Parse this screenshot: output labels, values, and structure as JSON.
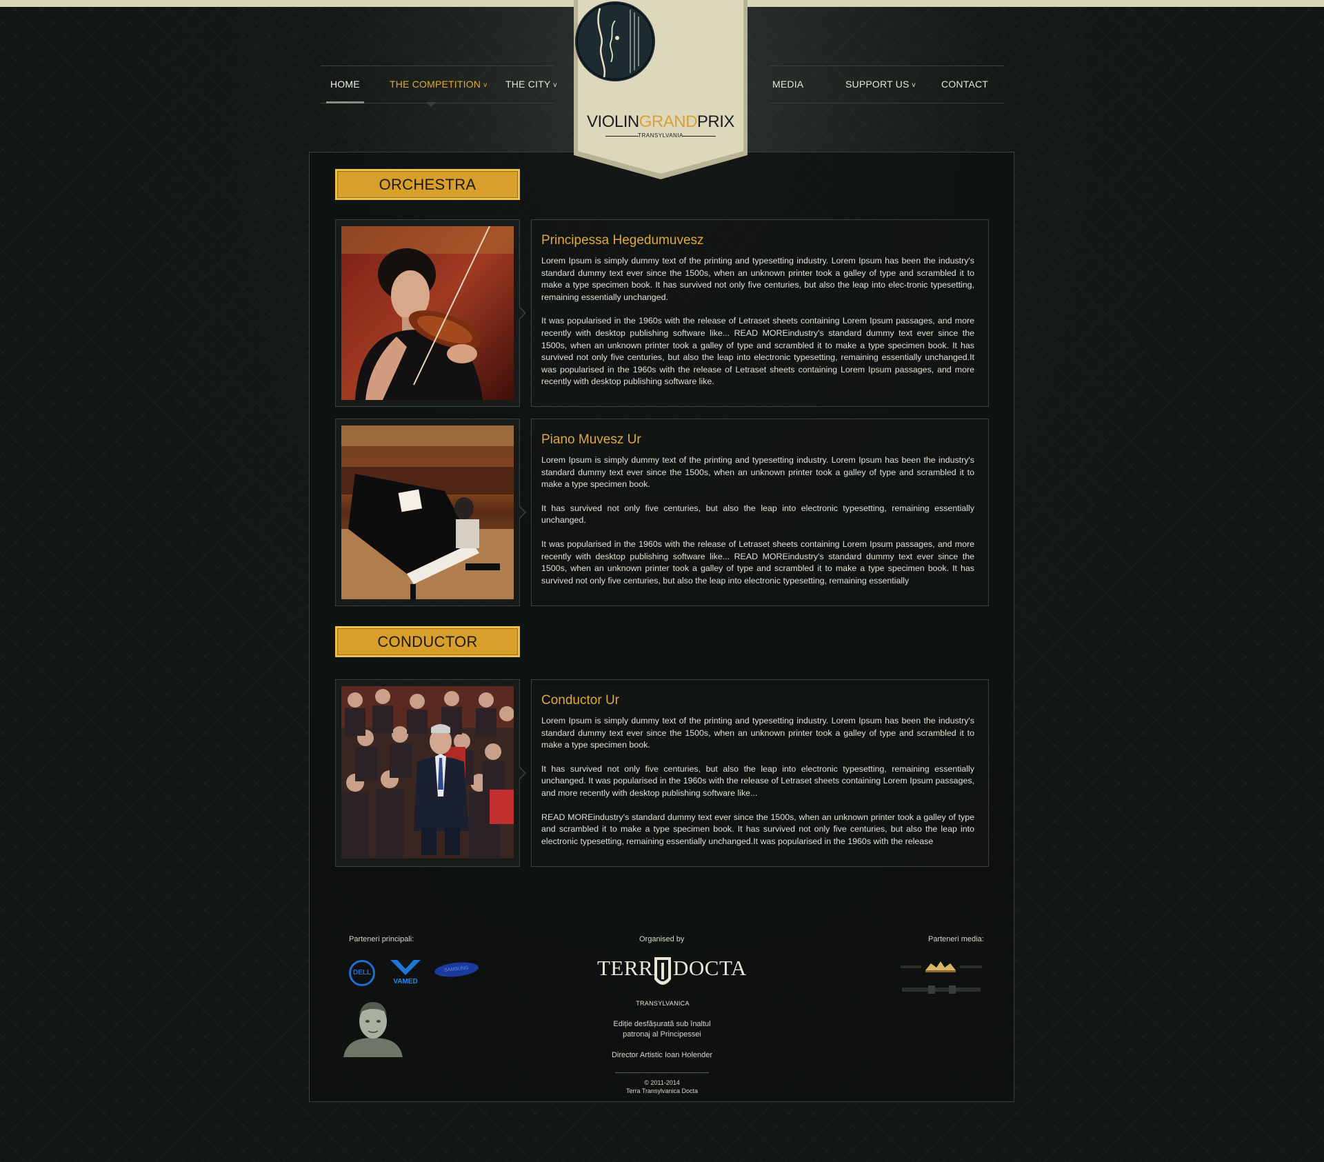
{
  "nav": {
    "left": [
      {
        "label": "HOME",
        "chevron": ""
      },
      {
        "label": "THE COMPETITION",
        "chevron": "v"
      },
      {
        "label": "THE CITY",
        "chevron": "v"
      }
    ],
    "right": [
      {
        "label": "MEDIA",
        "chevron": ""
      },
      {
        "label": "SUPPORT US",
        "chevron": "v"
      },
      {
        "label": "CONTACT",
        "chevron": ""
      }
    ]
  },
  "logo": {
    "word1": "VIOLIN",
    "word2": "GRAND",
    "word3": "PRIX",
    "subtitle": "TRANSYLVANIA",
    "emblem_icon": "violin-scroll-emblem-icon"
  },
  "sections": [
    {
      "label": "ORCHESTRA"
    },
    {
      "label": "CONDUCTOR"
    }
  ],
  "entries": [
    {
      "name": "Principessa Hegedumuvesz",
      "photo": "violinist-photo",
      "paragraphs": [
        "Lorem Ipsum is simply dummy text of the printing and typesetting industry. Lorem Ipsum has been the industry's standard dummy text ever since the 1500s, when an unknown printer took a galley of type and scrambled it to make a type specimen book. It has survived not only five centuries, but also the leap into elec-tronic typesetting, remaining essentially unchanged.",
        "It was popularised in the 1960s with the release of Letraset sheets containing Lorem Ipsum passages, and more recently with desktop publishing software like... READ MOREindustry's standard dummy text ever since the 1500s, when an unknown printer took a galley of type and scrambled it to make a type specimen book. It has survived not only five centuries, but also the leap into electronic typesetting, remaining essentially unchanged.It was popularised in the 1960s with the release of Letraset sheets containing Lorem Ipsum passages, and more recently with desktop publishing software like."
      ]
    },
    {
      "name": "Piano Muvesz Ur",
      "photo": "pianist-photo",
      "paragraphs": [
        "Lorem Ipsum is simply dummy text of the printing and typesetting industry. Lorem Ipsum has been the industry's standard dummy text ever since the 1500s, when an unknown printer took a galley of type and scrambled it to make a type specimen book.",
        "It has survived not only five centuries, but also the leap into electronic typesetting, remaining essentially unchanged.",
        "It was popularised in the 1960s with the release of Letraset sheets containing Lorem Ipsum passages, and more recently with desktop publishing software like... READ MOREindustry's standard dummy text ever since the 1500s, when an unknown printer took a galley of type and scrambled it to make a type specimen book. It has survived not only five centuries, but also the leap into electronic typesetting, remaining essentially"
      ]
    },
    {
      "name": "Conductor Ur",
      "photo": "conductor-photo",
      "paragraphs": [
        "Lorem Ipsum is simply dummy text of the printing and typesetting industry. Lorem Ipsum has been the industry's standard dummy text ever since the 1500s, when an unknown printer took a galley of type and scrambled it to make a type specimen book.",
        "It has survived not only five centuries, but also the leap into electronic typesetting, remaining essentially unchanged. It was popularised in the 1960s with the release of Letraset sheets containing Lorem Ipsum passages, and more recently with desktop publishing software like...",
        "READ MOREindustry's standard dummy text ever since the 1500s, when an unknown printer took a galley of type and scrambled it to make a type specimen book. It has survived not only five centuries, but also the leap into electronic typesetting, remaining essentially unchanged.It was popularised in the 1960s with the release"
      ]
    }
  ],
  "footer": {
    "partners_label": "Parteneri principali:",
    "partner_logos": [
      "DELL",
      "VAMED",
      "SAMSUNG"
    ],
    "organised_label": "Organised by",
    "org_logo": {
      "left": "TERRA",
      "right": "DOCTA",
      "sub": "TRANSYLVANICA"
    },
    "patronage_line1": "Ediție desfășurată sub înaltul",
    "patronage_line2": "patronaj al Principessei",
    "director": "Director Artistic Ioan Holender",
    "copyright": "© 2011-2014",
    "copyright_org": "Terra Transylvanica Docta",
    "media_label": "Parteneri media:",
    "media_logo_icons": [
      "gazette-masthead-icon",
      "newspaper-masthead-icon"
    ],
    "colors": {
      "accent": "#d8a02a",
      "heading": "#e0a840",
      "banner": "#dcd6b8"
    }
  }
}
